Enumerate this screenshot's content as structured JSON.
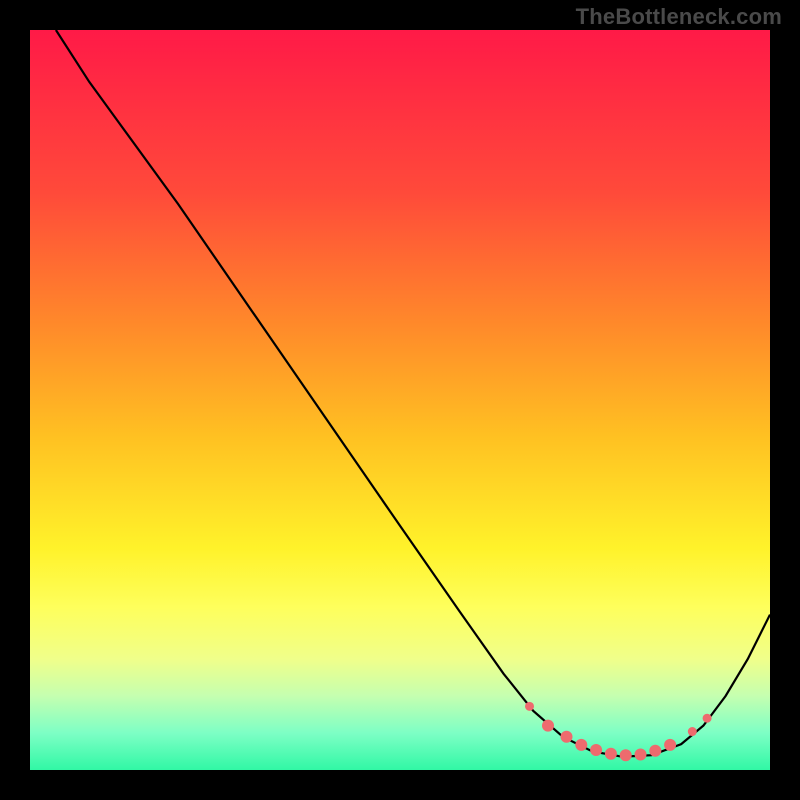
{
  "watermark": "TheBottleneck.com",
  "chart_data": {
    "type": "line",
    "title": "",
    "xlabel": "",
    "ylabel": "",
    "xlim": [
      0,
      100
    ],
    "ylim": [
      0,
      100
    ],
    "gradient_stops": [
      {
        "offset": 0,
        "color": "#ff1a47"
      },
      {
        "offset": 22,
        "color": "#ff4a3a"
      },
      {
        "offset": 40,
        "color": "#ff8a2a"
      },
      {
        "offset": 55,
        "color": "#ffc122"
      },
      {
        "offset": 70,
        "color": "#fff22a"
      },
      {
        "offset": 78,
        "color": "#feff5c"
      },
      {
        "offset": 85,
        "color": "#f0ff8a"
      },
      {
        "offset": 90,
        "color": "#c5ffb0"
      },
      {
        "offset": 95,
        "color": "#7dffc5"
      },
      {
        "offset": 100,
        "color": "#31f7a5"
      }
    ],
    "series": [
      {
        "name": "curve",
        "stroke": "#000000",
        "points": [
          {
            "x": 3.5,
            "y": 100
          },
          {
            "x": 8,
            "y": 93
          },
          {
            "x": 12,
            "y": 87.5
          },
          {
            "x": 20,
            "y": 76.5
          },
          {
            "x": 30,
            "y": 62
          },
          {
            "x": 40,
            "y": 47.5
          },
          {
            "x": 50,
            "y": 33
          },
          {
            "x": 58,
            "y": 21.5
          },
          {
            "x": 64,
            "y": 13
          },
          {
            "x": 68,
            "y": 8
          },
          {
            "x": 72,
            "y": 4.5
          },
          {
            "x": 76,
            "y": 2.5
          },
          {
            "x": 80,
            "y": 1.8
          },
          {
            "x": 84,
            "y": 2
          },
          {
            "x": 88,
            "y": 3.5
          },
          {
            "x": 91,
            "y": 6
          },
          {
            "x": 94,
            "y": 10
          },
          {
            "x": 97,
            "y": 15
          },
          {
            "x": 100,
            "y": 21
          }
        ]
      }
    ],
    "markers": [
      {
        "x": 67.5,
        "y": 8.6,
        "r": 4.5
      },
      {
        "x": 70,
        "y": 6,
        "r": 6
      },
      {
        "x": 72.5,
        "y": 4.5,
        "r": 6
      },
      {
        "x": 74.5,
        "y": 3.4,
        "r": 6
      },
      {
        "x": 76.5,
        "y": 2.7,
        "r": 6
      },
      {
        "x": 78.5,
        "y": 2.2,
        "r": 6
      },
      {
        "x": 80.5,
        "y": 2,
        "r": 6
      },
      {
        "x": 82.5,
        "y": 2.1,
        "r": 6
      },
      {
        "x": 84.5,
        "y": 2.6,
        "r": 6
      },
      {
        "x": 86.5,
        "y": 3.4,
        "r": 6
      },
      {
        "x": 89.5,
        "y": 5.2,
        "r": 4.5
      },
      {
        "x": 91.5,
        "y": 7,
        "r": 4.5
      }
    ],
    "marker_color": "#ee6b6e"
  }
}
